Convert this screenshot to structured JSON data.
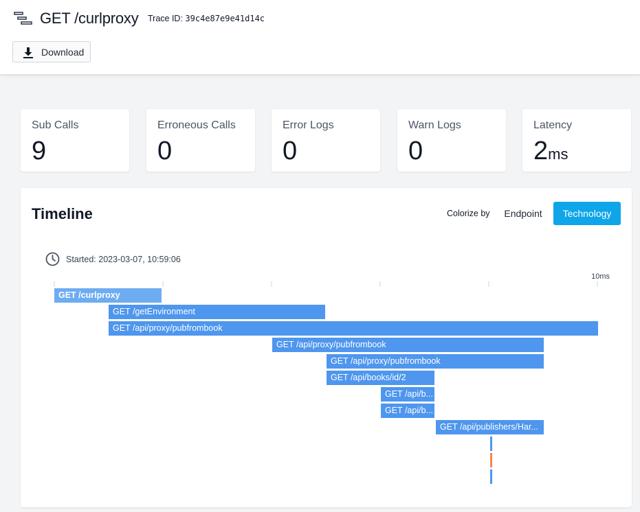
{
  "header": {
    "title": "GET /curlproxy",
    "trace_id_label": "Trace ID:",
    "trace_id": "39c4e87e9e41d14c",
    "download_label": "Download"
  },
  "stats": [
    {
      "label": "Sub Calls",
      "value": "9",
      "unit": ""
    },
    {
      "label": "Erroneous Calls",
      "value": "0",
      "unit": ""
    },
    {
      "label": "Error Logs",
      "value": "0",
      "unit": ""
    },
    {
      "label": "Warn Logs",
      "value": "0",
      "unit": ""
    },
    {
      "label": "Latency",
      "value": "2",
      "unit": "ms"
    }
  ],
  "timeline": {
    "title": "Timeline",
    "colorize_label": "Colorize by",
    "colorize_options": [
      "Endpoint",
      "Technology"
    ],
    "colorize_selected": "Technology",
    "started_label": "Started: 2023-03-07, 10:59:06",
    "scale_label": "10ms",
    "spans": [
      {
        "label": "GET /curlproxy"
      },
      {
        "label": "GET /getEnvironment"
      },
      {
        "label": "GET /api/proxy/pubfrombook"
      },
      {
        "label": "GET /api/proxy/pubfrombook"
      },
      {
        "label": "GET /api/proxy/pubfrombook"
      },
      {
        "label": "GET /api/books/id/2"
      },
      {
        "label": "GET /api/b..."
      },
      {
        "label": "GET /api/b..."
      },
      {
        "label": "GET /api/publishers/Har..."
      }
    ]
  },
  "colors": {
    "accent": "#0ea5e9",
    "span": "#4e96ee",
    "root_span": "#6eacf2",
    "marker_orange": "#f08a4b"
  }
}
